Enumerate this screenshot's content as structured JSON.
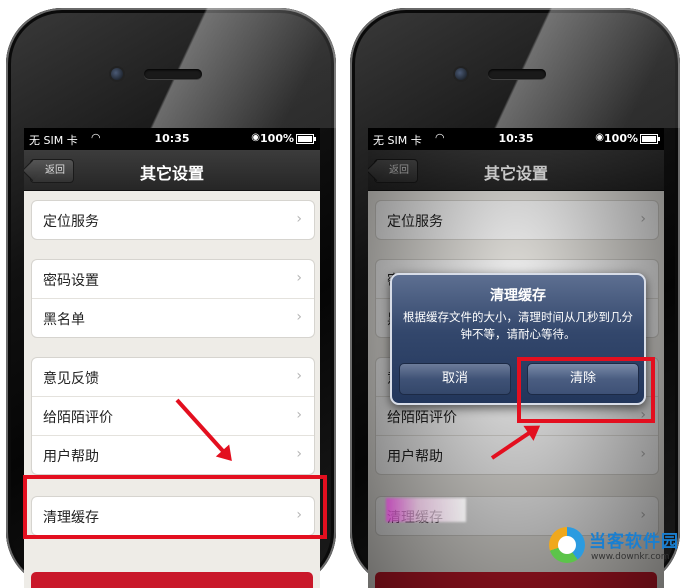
{
  "status": {
    "carrier": "无 SIM 卡",
    "time": "10:35",
    "battery_pct": "100%",
    "battery_level": 1.0
  },
  "nav": {
    "back_label": "返回",
    "title": "其它设置"
  },
  "settings": {
    "location": "定位服务",
    "password": "密码设置",
    "blacklist": "黑名单",
    "feedback": "意见反馈",
    "rate": "给陌陌评价",
    "help": "用户帮助",
    "clear_cache": "清理缓存"
  },
  "alert": {
    "title": "清理缓存",
    "message": "根据缓存文件的大小，清理时间从几秒到几分钟不等，请耐心等待。",
    "cancel": "取消",
    "confirm": "清除"
  },
  "watermark": {
    "name": "当客软件园",
    "url": "www.downkr.com"
  },
  "colors": {
    "highlight": "#e30f1f",
    "navbar": "#2e2e2e",
    "alert": "#33476c",
    "logout": "#c9182a"
  }
}
